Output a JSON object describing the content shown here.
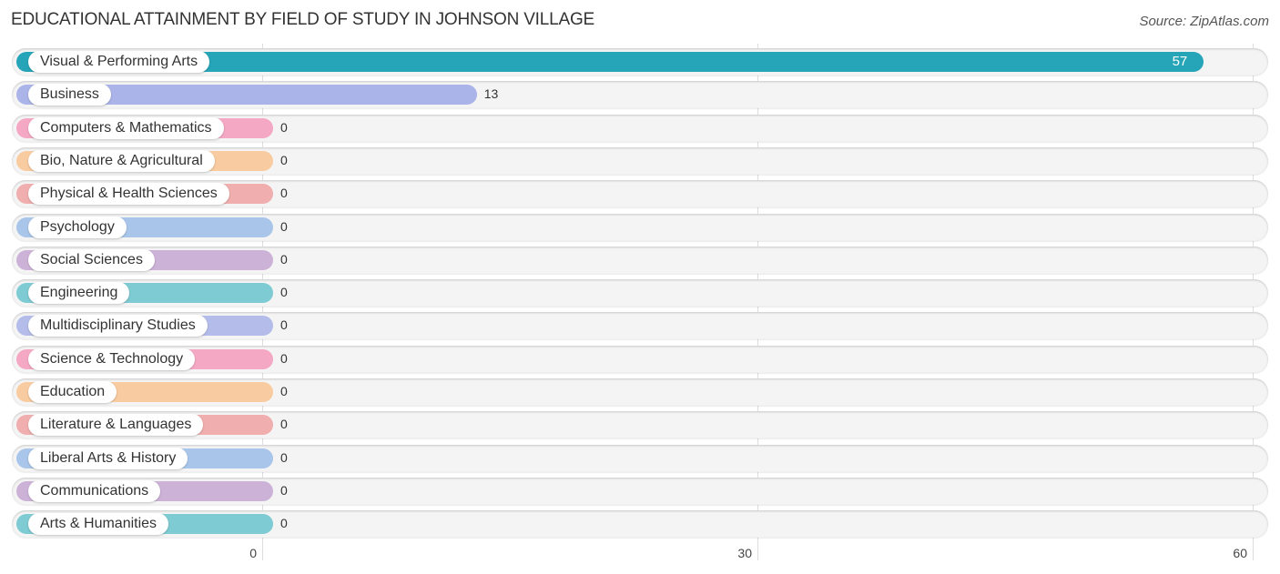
{
  "header": {
    "title": "EDUCATIONAL ATTAINMENT BY FIELD OF STUDY IN JOHNSON VILLAGE",
    "source": "Source: ZipAtlas.com"
  },
  "chart_data": {
    "type": "bar",
    "orientation": "horizontal",
    "title": "EDUCATIONAL ATTAINMENT BY FIELD OF STUDY IN JOHNSON VILLAGE",
    "xlabel": "",
    "ylabel": "",
    "xlim": [
      0,
      60
    ],
    "xticks": [
      0,
      30,
      60
    ],
    "grid": true,
    "categories": [
      "Visual & Performing Arts",
      "Business",
      "Computers & Mathematics",
      "Bio, Nature & Agricultural",
      "Physical & Health Sciences",
      "Psychology",
      "Social Sciences",
      "Engineering",
      "Multidisciplinary Studies",
      "Science & Technology",
      "Education",
      "Literature & Languages",
      "Liberal Arts & History",
      "Communications",
      "Arts & Humanities"
    ],
    "values": [
      57,
      13,
      0,
      0,
      0,
      0,
      0,
      0,
      0,
      0,
      0,
      0,
      0,
      0,
      0
    ],
    "colors": [
      "#26a5b8",
      "#aab4e8",
      "#f5a8c4",
      "#f9cba0",
      "#f0aeae",
      "#a9c6ea",
      "#cdb2d8",
      "#7fcbd3",
      "#b4bdea",
      "#f5a8c4",
      "#f9cba0",
      "#f0aeae",
      "#a9c6ea",
      "#cdb2d8",
      "#7fcbd3"
    ]
  }
}
